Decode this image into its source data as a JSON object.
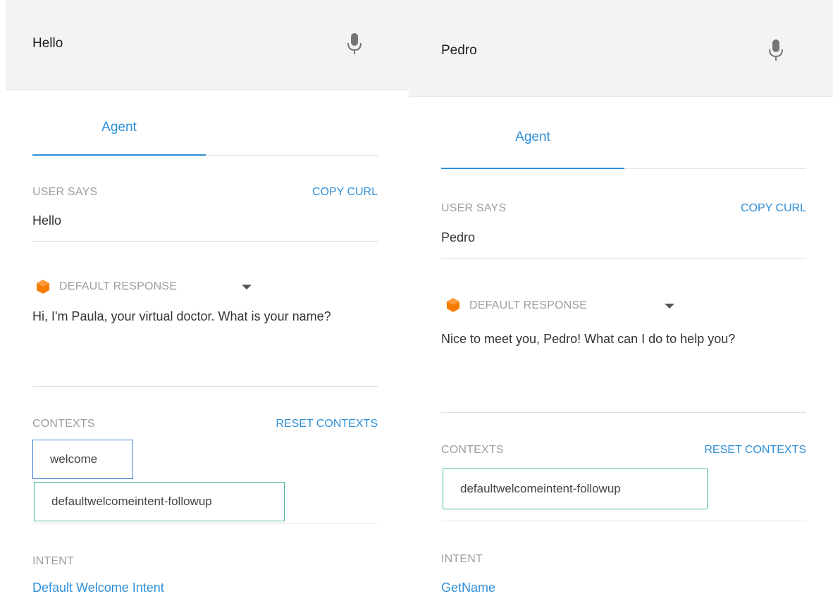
{
  "panels": [
    {
      "query": "Hello",
      "tab_label": "Agent",
      "user_says_label": "USER SAYS",
      "copy_curl_label": "COPY CURL",
      "user_says_value": "Hello",
      "default_response_label": "DEFAULT RESPONSE",
      "response_text": "Hi, I'm Paula, your virtual doctor. What is your name?",
      "contexts_label": "CONTEXTS",
      "reset_contexts_label": "RESET CONTEXTS",
      "contexts": [
        "welcome",
        "defaultwelcomeintent-followup"
      ],
      "intent_label": "INTENT",
      "intent_name": "Default Welcome Intent"
    },
    {
      "query": "Pedro",
      "tab_label": "Agent",
      "user_says_label": "USER SAYS",
      "copy_curl_label": "COPY CURL",
      "user_says_value": "Pedro",
      "default_response_label": "DEFAULT RESPONSE",
      "response_text": "Nice to meet you, Pedro! What can I do to help you?",
      "contexts_label": "CONTEXTS",
      "reset_contexts_label": "RESET CONTEXTS",
      "contexts": [
        "defaultwelcomeintent-followup"
      ],
      "intent_label": "INTENT",
      "intent_name": "GetName"
    }
  ],
  "icons": {
    "mic": "microphone-icon",
    "agent": "agent-avatar-icon",
    "dropdown": "caret-down-icon"
  },
  "colors": {
    "accent": "#2f8fd8",
    "topbar": "#f3f3f3",
    "label": "#9e9e9e",
    "context_blue": "#3f7fd0",
    "context_green": "#4fb89a",
    "agent_orange": "#f57c00"
  }
}
